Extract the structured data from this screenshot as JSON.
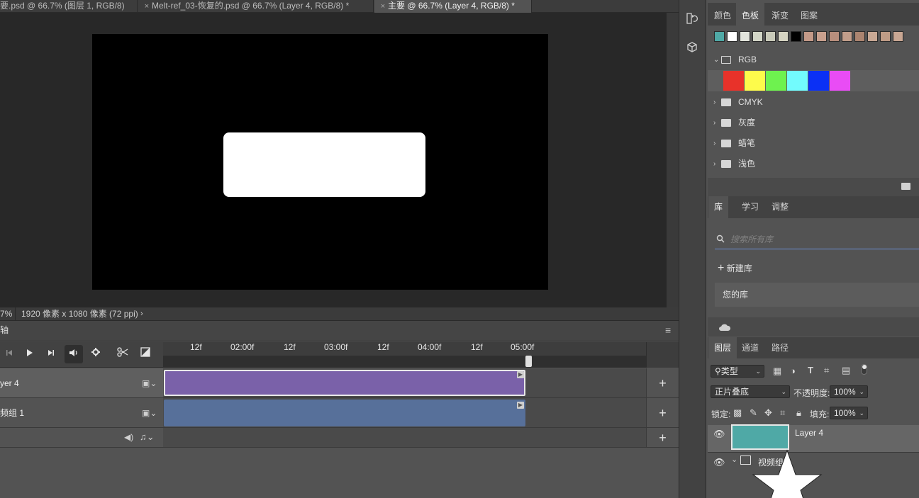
{
  "tabs": [
    {
      "label": "要.psd @ 66.7% (图层 1, RGB/8)",
      "active": false
    },
    {
      "label": "Melt-ref_03-恢复的.psd @ 66.7% (Layer 4, RGB/8) *",
      "active": false
    },
    {
      "label": "主要 @ 66.7% (Layer 4, RGB/8) *",
      "active": true
    }
  ],
  "status": {
    "zoom": "7%",
    "doc_info": "1920 像素 x 1080 像素 (72 ppi)",
    "arrow": "›"
  },
  "timeline": {
    "tab_label": "轴",
    "menu_icon": "≡",
    "ruler_labels": [
      "12f",
      "02:00f",
      "12f",
      "03:00f",
      "12f",
      "04:00f",
      "12f",
      "05:00f"
    ],
    "tracks": [
      {
        "name": "yer 4",
        "clip_color": "#7a61a9"
      },
      {
        "name": "频组 1",
        "clip_color": "#57709a"
      }
    ],
    "plus": "+"
  },
  "panels": {
    "swatch_tabs": [
      "颜色",
      "色板",
      "渐变",
      "图案"
    ],
    "swatches_top": [
      "#4fa9a6",
      "#ffffff",
      "#e2e4dc",
      "#d3d6c7",
      "#c9cab9",
      "#d6d4c2",
      "#000000",
      "#c49a88",
      "#c8a08e",
      "#b88f7d",
      "#c29e8b",
      "#ab8470",
      "#c8a894",
      "#bf9c86",
      "#c9a793"
    ],
    "folders": [
      {
        "label": "RGB",
        "open": true
      },
      {
        "label": "CMYK",
        "open": false
      },
      {
        "label": "灰度",
        "open": false
      },
      {
        "label": "蜡笔",
        "open": false
      },
      {
        "label": "浅色",
        "open": false
      }
    ],
    "rgb_swatches": [
      "#e8322a",
      "#fdfb4b",
      "#6ef24f",
      "#72fbfd",
      "#0b30f5",
      "#e94cf5"
    ],
    "library_tabs": [
      "库",
      "学习",
      "调整"
    ],
    "library_search_placeholder": "搜索所有库",
    "new_library": "新建库",
    "your_libraries": "您的库",
    "layers_tabs": [
      "图层",
      "通道",
      "路径"
    ],
    "filter_label": "类型",
    "blend_mode": "正片叠底",
    "opacity_label": "不透明度:",
    "opacity_value": "100%",
    "lock_label": "锁定:",
    "fill_label": "填充:",
    "fill_value": "100%",
    "layers": [
      {
        "name": "Layer 4",
        "thumb_color": "#4fa9a6"
      },
      {
        "name": "视频组"
      }
    ]
  }
}
